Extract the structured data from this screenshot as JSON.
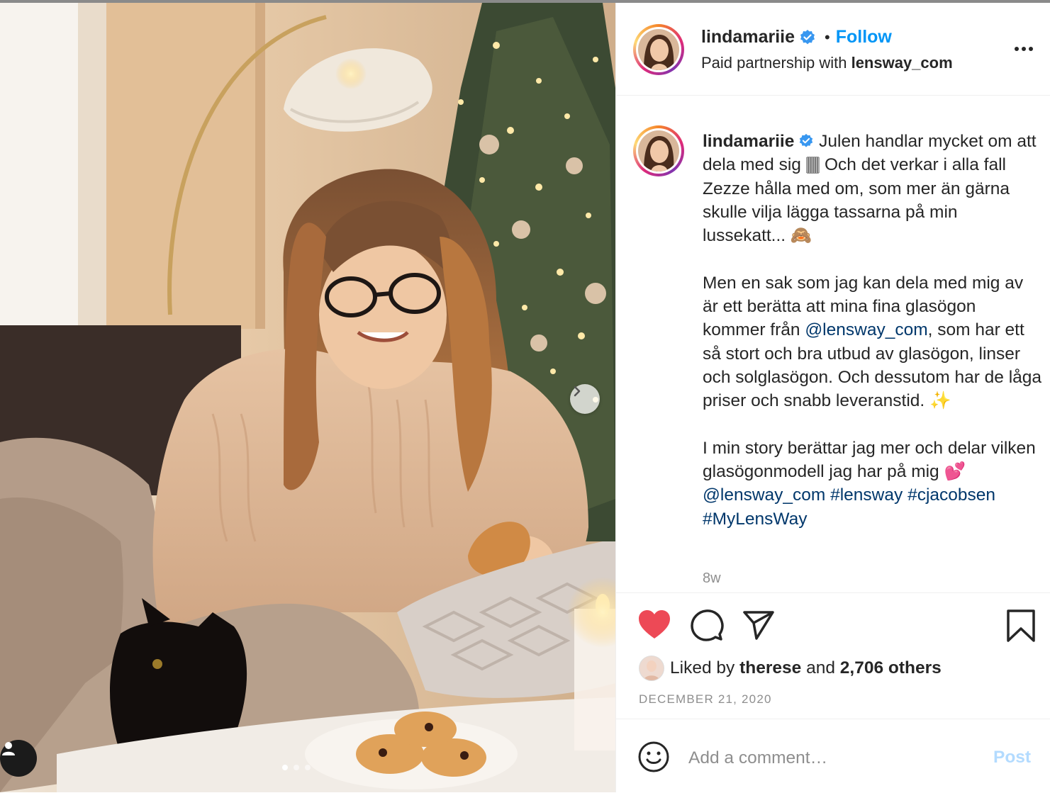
{
  "post": {
    "username": "lindamariie",
    "follow_label": "Follow",
    "separator": "•",
    "partner_prefix": "Paid partnership with",
    "partner_name": "lensway_com",
    "photo_carousel": {
      "slides": 3,
      "active_index": 0
    }
  },
  "caption": {
    "username": "lindamariie",
    "p1": " Julen handlar mycket om att dela med sig 🀫 Och det verkar i alla fall Zezze hålla med om, som mer än gärna skulle vilja lägga tassarna på min lussekatt... 🙈",
    "p2_a": "Men en sak som jag kan dela med mig av är ett berätta att mina fina glasögon kommer från ",
    "p2_link": "@lensway_com",
    "p2_b": ", som har ett så stort och bra utbud av glasögon, linser och solglasögon. Och dessutom har de låga priser och snabb leveranstid. ✨",
    "p3_a": "I min story berättar jag mer och delar vilken glasögonmodell jag har på mig 💕 ",
    "p3_link1": "@lensway_com",
    "p3_tag1": "#lensway",
    "p3_tag2": "#cjacobsen",
    "p3_tag3": "#MyLensWay",
    "time": "8w"
  },
  "engagement": {
    "liked_prefix": "Liked by",
    "liked_user": "therese",
    "liked_and": "and",
    "liked_count": "2,706 others",
    "date": "DECEMBER 21, 2020",
    "liked": true
  },
  "comment_box": {
    "placeholder": "Add a comment…",
    "post_label": "Post"
  },
  "icons": [
    "heart-icon",
    "comment-icon",
    "share-icon",
    "bookmark-icon",
    "more-icon",
    "verified-badge-icon",
    "emoji-icon",
    "chevron-right-icon",
    "user-tag-icon"
  ],
  "colors": {
    "accent": "#0095f6",
    "liked_heart": "#ed4956",
    "link": "#00376b",
    "post_disabled": "#b3dbff"
  }
}
